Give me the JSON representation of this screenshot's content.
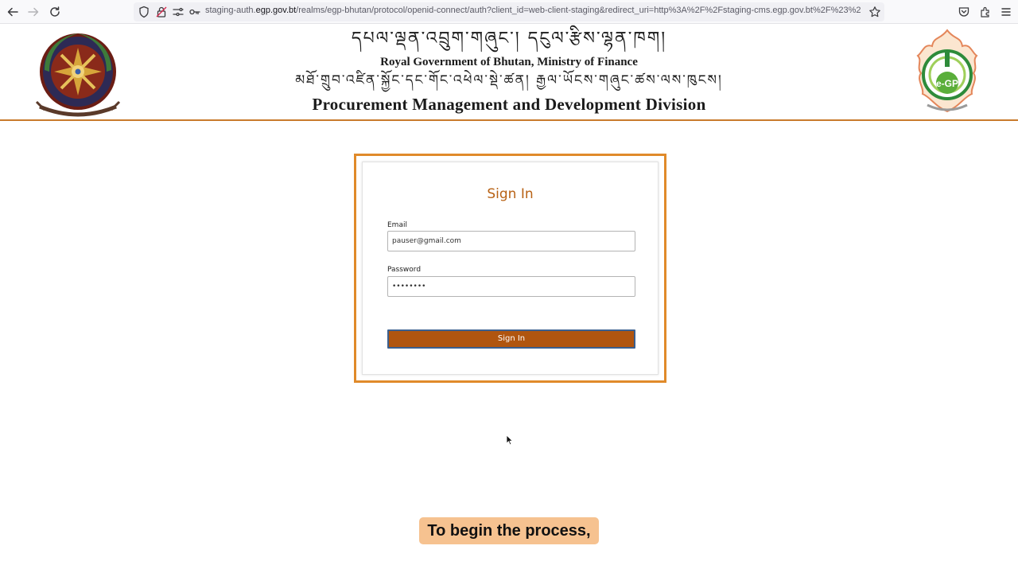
{
  "browser": {
    "url_scheme_host": "staging-auth.",
    "url_domain": "egp.gov.bt",
    "url_path": "/realms/egp-bhutan/protocol/openid-connect/auth?client_id=web-client-staging&redirect_uri=http%3A%2F%2Fstaging-cms.egp.gov.bt%2F%23%2"
  },
  "header": {
    "tibetan_line1": "དཔལ་ལྡན་འབྲུག་གཞུང་། དངུལ་རྩིས་ལྷན་ཁག།",
    "ministry": "Royal Government of Bhutan, Ministry of Finance",
    "tibetan_line2": "མཐོ་གྲུབ་འཛིན་སྐྱོང་དང་གོང་འཕེལ་སྡེ་ཚན། རྒྱལ་ཡོངས་གཞུང་ཚས་ལས་ཁུངས།",
    "division": "Procurement Management and Development Division",
    "logo_text": "e-GP"
  },
  "signin": {
    "title": "Sign In",
    "email_label": "Email",
    "email_value": "pauser@gmail.com",
    "password_label": "Password",
    "password_value": "••••••••",
    "button_label": "Sign In"
  },
  "caption": "To begin the process,",
  "colors": {
    "accent_orange": "#e08a2a",
    "title_orange": "#b86215",
    "button_brown": "#b0550f",
    "caption_bg": "#f6c290"
  }
}
